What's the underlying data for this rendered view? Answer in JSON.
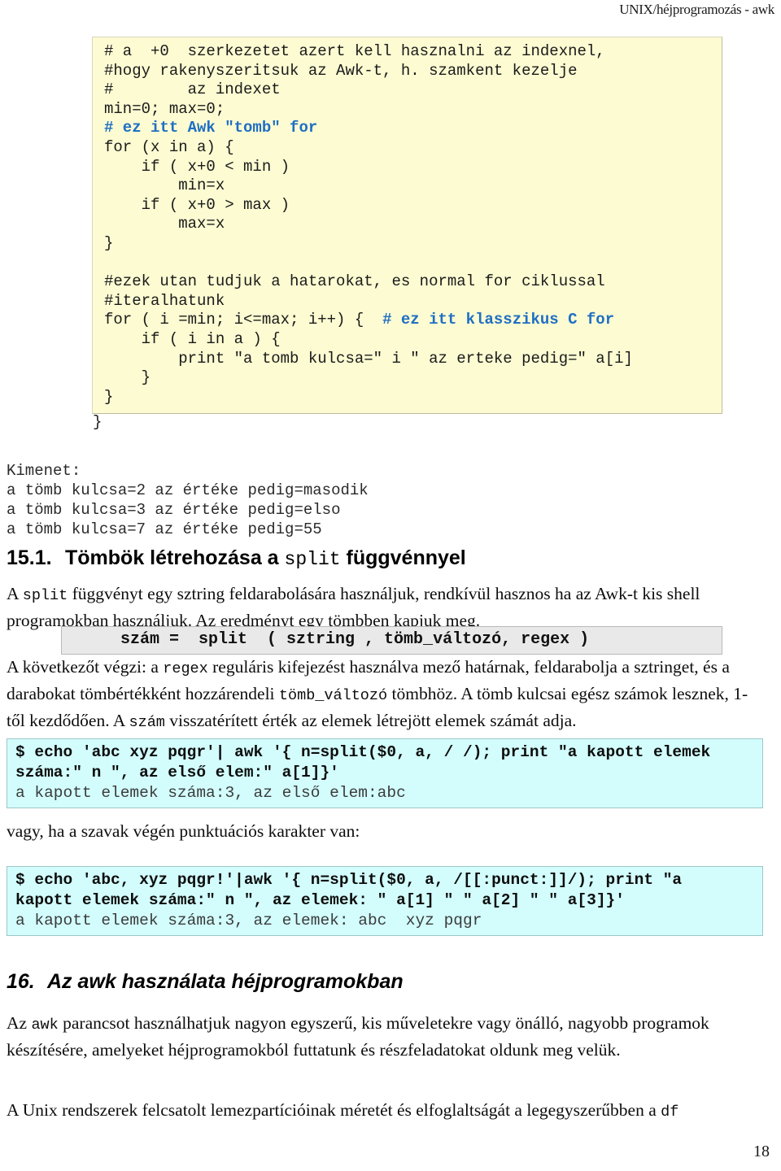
{
  "header": {
    "running_title": "UNIX/héjprogramozás - awk"
  },
  "code_block": {
    "lines_pre": "# a  +0  szerkezetet azert kell hasznalni az indexnel,\n#hogy rakenyszeritsuk az Awk-t, h. szamkent kezelje\n#        az indexet\nmin=0; max=0;\n",
    "comment_awk_for": "# ez itt Awk \"tomb\" for",
    "lines_mid": "\nfor (x in a) {\n    if ( x+0 < min )\n        min=x\n    if ( x+0 > max )\n        max=x\n}\n\n#ezek utan tudjuk a hatarokat, es normal for ciklussal\n#iteralhatunk\nfor ( i =min; i<=max; i++) {  ",
    "comment_c_for": "# ez itt klasszikus C for",
    "lines_post": "\n    if ( i in a ) {\n        print \"a tomb kulcsa=\" i \" az erteke pedig=\" a[i]\n    }\n}",
    "closing_brace": "}",
    "highlight_color": "#1f6fc4",
    "background_color": "#fcfbd2"
  },
  "output_block": {
    "text": "Kimenet:\na tömb kulcsa=2 az értéke pedig=masodik\na tömb kulcsa=3 az értéke pedig=elso\na tömb kulcsa=7 az értéke pedig=55"
  },
  "section_15_1": {
    "number": "15.1.",
    "title_part1": "Tömbök létrehozása a ",
    "title_mono": "split",
    "title_part2": " függvénnyel",
    "paragraph_a_1": "A ",
    "paragraph_a_mono": "split",
    "paragraph_a_2": " függvényt egy sztring feldarabolására használjuk, rendkívül hasznos ha az Awk-t kis shell programokban használjuk. Az eredményt egy tömbben kapjuk meg.",
    "syntax_line": "szám =  split  ( sztring , tömb_változó, regex )",
    "paragraph_b_1": "A következőt végzi: a ",
    "paragraph_b_mono1": "regex",
    "paragraph_b_2": " reguláris kifejezést használva mező határnak, feldarabolja a sztringet, és a darabokat tömbértékként hozzárendeli ",
    "paragraph_b_mono2": "tömb_változó",
    "paragraph_b_3": " tömbhöz. A tömb  kulcsai egész számok lesznek, 1-től kezdődően. A ",
    "paragraph_b_mono3": "szám",
    "paragraph_b_4": " visszatérített érték az elemek létrejött elemek számát adja.",
    "paragraph_c": "vagy,  ha a szavak végén punktuációs karakter van:"
  },
  "shell_example_1": {
    "command": "$ echo 'abc xyz pqgr'| awk '{ n=split($0, a, / /); print \"a kapott elemek\nszáma:\" n \", az első elem:\" a[1]}'",
    "output": "a kapott elemek száma:3, az első elem:abc",
    "background_color": "#d3fdfd"
  },
  "shell_example_2": {
    "command": "$ echo 'abc, xyz pqgr!'|awk '{ n=split($0, a, /[[:punct:]]/); print \"a\nkapott elemek száma:\" n \", az elemek: \" a[1] \" \" a[2] \" \" a[3]}'",
    "output": "a kapott elemek száma:3, az elemek: abc  xyz pqgr",
    "background_color": "#d3fdfd"
  },
  "section_16": {
    "number": "16.",
    "title": "Az awk használata héjprogramokban",
    "paragraph_1_1": "Az ",
    "paragraph_1_mono": "awk",
    "paragraph_1_2": " parancsot használhatjuk nagyon egyszerű, kis műveletekre vagy önálló, nagyobb programok készítésére, amelyeket héjprogramokból futtatunk és részfeladatokat oldunk meg velük.",
    "paragraph_2_1": "A Unix rendszerek felcsatolt lemezpartícióinak méretét és elfoglaltságát a legegyszerűbben a ",
    "paragraph_2_mono": "df"
  },
  "footer": {
    "page_number": "18"
  }
}
